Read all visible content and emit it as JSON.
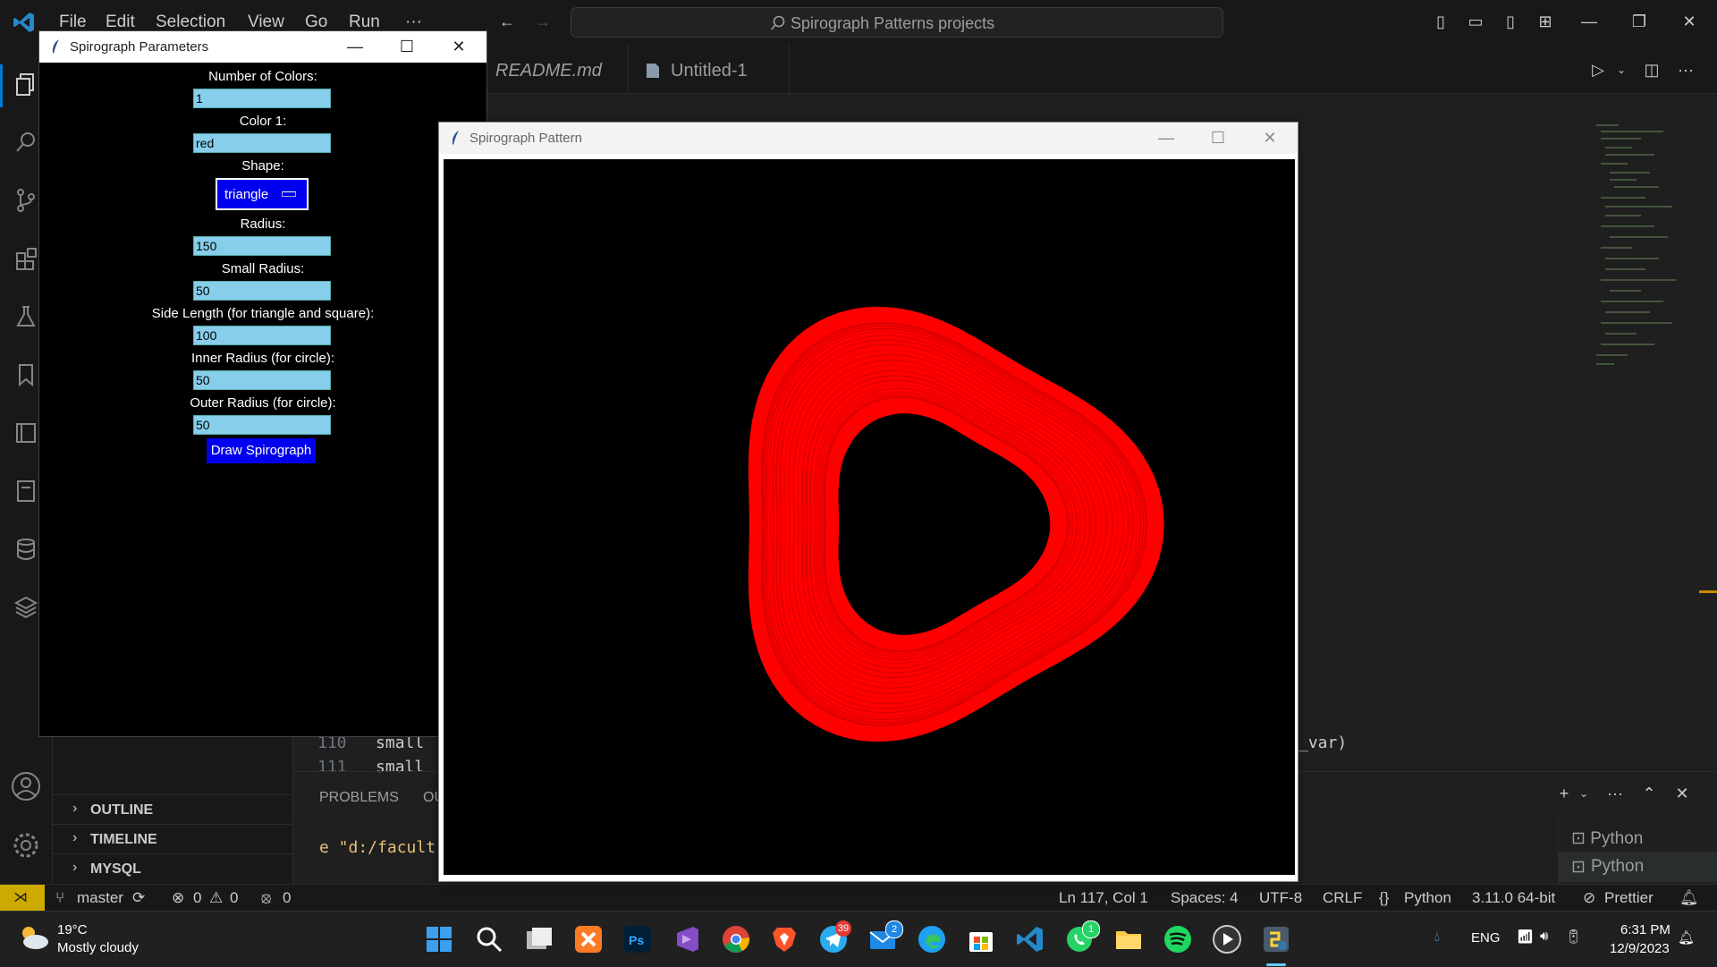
{
  "titlebar": {
    "menu": [
      "File",
      "Edit",
      "Selection",
      "View",
      "Go",
      "Run",
      "···"
    ],
    "search_text": "Spirograph Patterns projects"
  },
  "tabs": [
    {
      "label": "README.md"
    },
    {
      "label": "Untitled-1"
    }
  ],
  "editor": {
    "lines": [
      {
        "num": "110",
        "code": "small"
      },
      {
        "num": "111",
        "code": "small"
      }
    ],
    "right_fragment": "_var)",
    "terminal_line": "e \"d:/facult"
  },
  "panel": {
    "tabs": [
      "PROBLEMS",
      "OU"
    ],
    "terminals": [
      "Python",
      "Python"
    ]
  },
  "sidebar": {
    "sections": [
      "OUTLINE",
      "TIMELINE",
      "MYSQL"
    ]
  },
  "statusbar": {
    "branch": "master",
    "errors": "0",
    "warnings": "0",
    "ports": "0",
    "position": "Ln 117, Col 1",
    "spaces": "Spaces: 4",
    "encoding": "UTF-8",
    "eol": "CRLF",
    "language": "Python",
    "interpreter": "3.11.0 64-bit",
    "formatter": "Prettier"
  },
  "params_window": {
    "title": "Spirograph Parameters",
    "fields": [
      {
        "label": "Number of Colors:",
        "value": "1"
      },
      {
        "label": "Color 1:",
        "value": "red"
      }
    ],
    "shape_label": "Shape:",
    "shape_value": "triangle",
    "fields2": [
      {
        "label": "Radius:",
        "value": "150"
      },
      {
        "label": "Small Radius:",
        "value": "50"
      },
      {
        "label": "Side Length (for triangle and square):",
        "value": "100"
      },
      {
        "label": "Inner Radius (for circle):",
        "value": "50"
      },
      {
        "label": "Outer Radius (for circle):",
        "value": "50"
      }
    ],
    "draw_button": "Draw Spirograph"
  },
  "pattern_window": {
    "title": "Spirograph Pattern",
    "pattern_color": "#ff0000"
  },
  "taskbar": {
    "weather_temp": "19°C",
    "weather_desc": "Mostly cloudy",
    "telegram_badge": "39",
    "mail_badge": "2",
    "whatsapp_badge": "1",
    "language": "ENG",
    "time": "6:31 PM",
    "date": "12/9/2023"
  }
}
